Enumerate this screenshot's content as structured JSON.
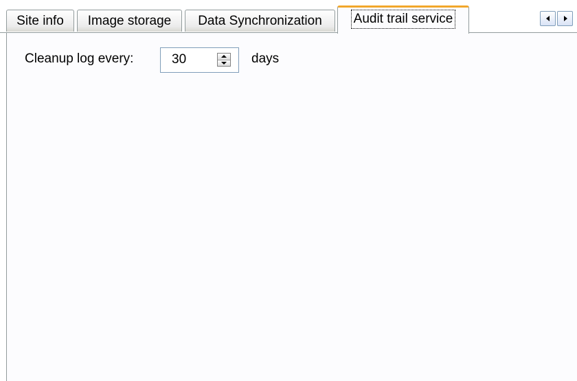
{
  "tabs": [
    {
      "label": "Site info",
      "active": false
    },
    {
      "label": "Image storage",
      "active": false
    },
    {
      "label": "Data Synchronization",
      "active": false
    },
    {
      "label": "Audit trail service",
      "active": true
    }
  ],
  "scroll_buttons": {
    "left_icon": "arrow-left-icon",
    "right_icon": "arrow-right-icon"
  },
  "cleanup": {
    "label": "Cleanup log every:",
    "value": "30",
    "unit": "days",
    "up_icon": "spinner-up-icon",
    "down_icon": "spinner-down-icon"
  },
  "colors": {
    "active_tab_accent": "#f2a72a",
    "panel_background": "#fcfcfe",
    "border": "#919b9c",
    "input_border": "#7f9db9"
  }
}
